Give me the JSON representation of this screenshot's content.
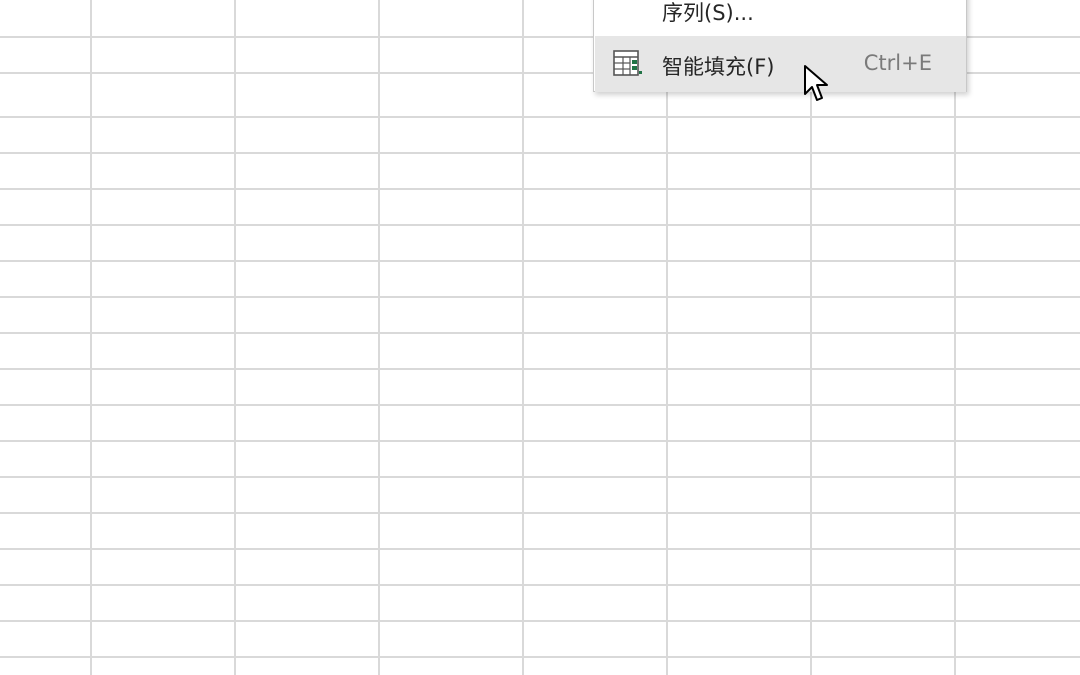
{
  "context_menu": {
    "items": [
      {
        "label": "序列(S)...",
        "shortcut": "",
        "icon": ""
      },
      {
        "label": "智能填充(F)",
        "shortcut": "Ctrl+E",
        "icon": "flash-fill-icon",
        "highlighted": true
      }
    ]
  },
  "colors": {
    "gridline": "#d9d9d9",
    "menu_highlight": "#e6e6e6",
    "menu_border": "#c8c8c8",
    "icon_green": "#217346"
  }
}
